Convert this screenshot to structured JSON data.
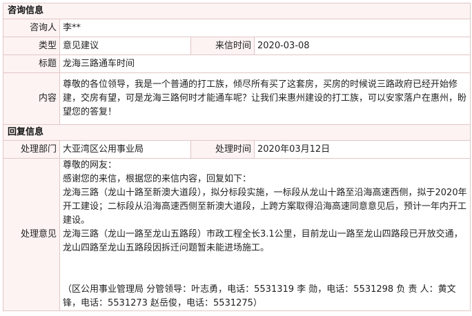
{
  "consult": {
    "section_title": "咨询信息",
    "inquirer_label": "咨询人",
    "inquirer_value": "李**",
    "type_label": "类型",
    "type_value": "意见建议",
    "date_label": "来信时间",
    "date_value": "2020-03-08",
    "subject_label": "标题",
    "subject_value": "龙海三路通车时间",
    "content_label": "内容",
    "content_value": "尊敬的各位领导，我是一个普通的打工族，倾尽所有买了这套房，买房的时候说三路政府已经开始修建，交房有望，可是龙海三路何时才能通车呢？让我们来惠州建设的打工族，可以安家落户在惠州，盼望您的答复！"
  },
  "reply": {
    "section_title": "回复信息",
    "dept_label": "处理部门",
    "dept_value": "大亚湾区公用事业局",
    "time_label": "处理时间",
    "time_value": "2020年03月12日",
    "opinion_label": "处理意见",
    "opinion_paragraphs": [
      "尊敬的网友：",
      "感谢您的来信，根据您的来信内容，回复如下：",
      "龙海三路（龙山十路至新澳大道段），拟分标段实施，一标段从龙山十路至沿海高速西侧，拟于2020年开工建设；二标段从沿海高速西侧至新澳大道段，上跨方案取得沿海高速同意意见后，预计一年内开工建设。",
      "龙海三路（龙山一路至龙山五路段）市政工程全长3.1公里，目前龙山一路至龙山四路段已开放交通，龙山四路至龙山五路段因拆迁问题暂未能进场施工。"
    ],
    "contact_note": "（区公用事业管理局 分管领导：叶志勇，电话：5531319 李 勋，电话：5531298 负 责 人：黄文锋，电话：5531273 赵岳俊，电话：5531275）"
  }
}
